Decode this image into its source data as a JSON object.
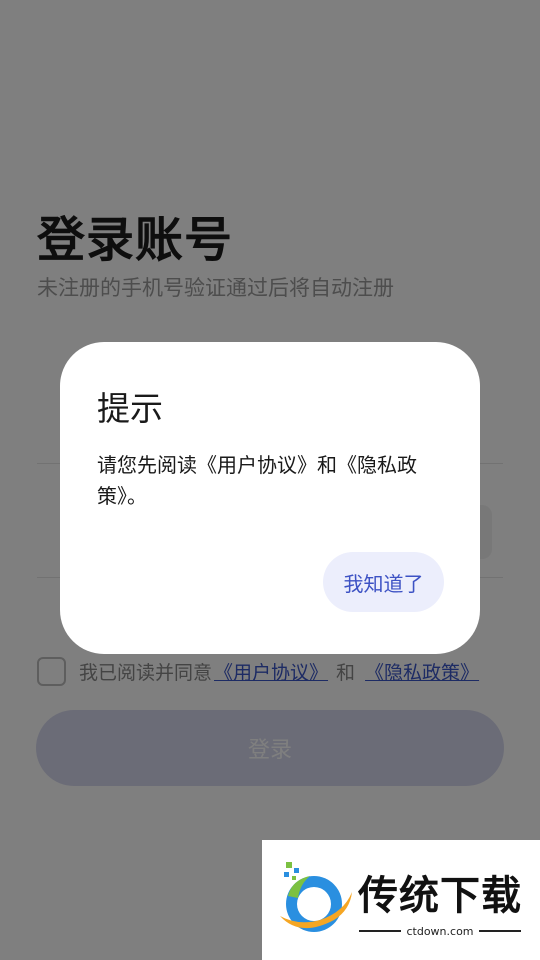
{
  "login": {
    "title": "登录账号",
    "subtitle": "未注册的手机号验证通过后将自动注册",
    "agreement": {
      "prefix": "我已阅读并同意",
      "user_agreement_link": "《用户协议》",
      "and": "和",
      "privacy_policy_link": "《隐私政策》",
      "checked": false
    },
    "login_button": "登录"
  },
  "dialog": {
    "title": "提示",
    "message": "请您先阅读《用户协议》和《隐私政策》。",
    "confirm_button": "我知道了"
  },
  "watermark": {
    "brand": "传统下载",
    "domain": "ctdown.com"
  },
  "colors": {
    "overlay": "#000000",
    "accent": "#3d52c4",
    "dialog_button_bg": "#eceefc"
  }
}
